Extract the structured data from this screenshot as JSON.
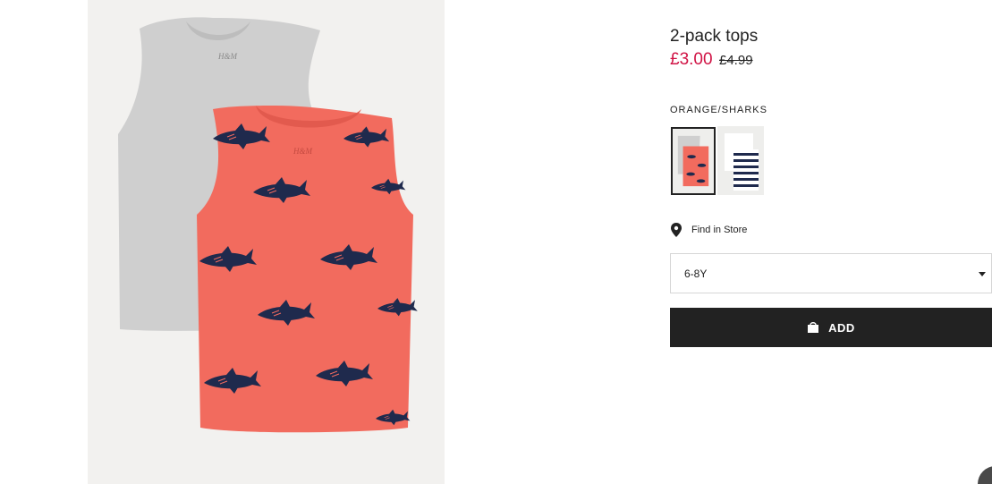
{
  "product": {
    "title": "2-pack tops",
    "price_current": "£3.00",
    "price_old": "£4.99",
    "image_icon": "product-photo"
  },
  "variants": {
    "color_label": "ORANGE/SHARKS",
    "swatches": [
      {
        "name": "orange-sharks",
        "selected": true
      },
      {
        "name": "white-navy-stripes",
        "selected": false
      }
    ]
  },
  "store": {
    "find_label": "Find in Store",
    "icon": "location-pin-icon"
  },
  "size": {
    "selected": "6-8Y",
    "icon": "caret-down-icon"
  },
  "cart": {
    "add_label": "ADD",
    "icon": "shopping-bag-icon"
  },
  "colors": {
    "sale_price": "#d01345",
    "button_bg": "#222222",
    "shirt_coral": "#f26b5e",
    "shirt_grey": "#cfcfcf",
    "shark_navy": "#1f2a4d"
  }
}
